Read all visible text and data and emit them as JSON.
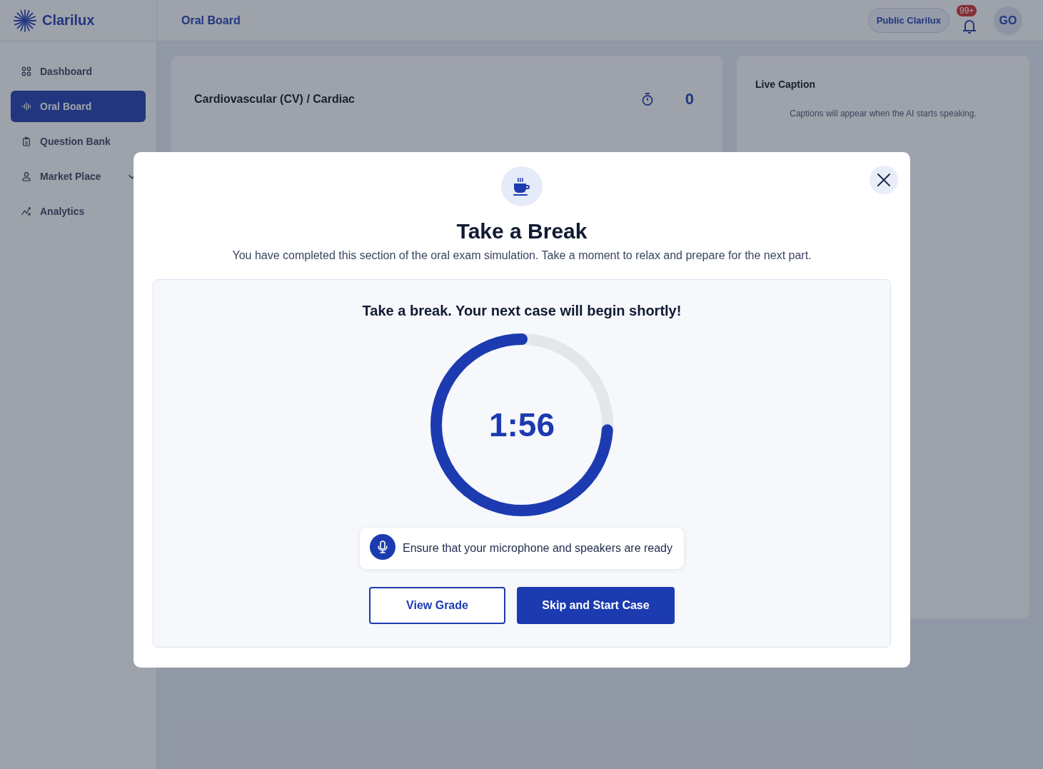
{
  "brand": {
    "name": "Clarilux"
  },
  "header": {
    "title": "Oral Board",
    "public_button": "Public Clarilux",
    "notification_badge": "99+",
    "avatar": "GO"
  },
  "sidebar": {
    "items": [
      {
        "label": "Dashboard",
        "selected": false,
        "kind": "link"
      },
      {
        "label": "Oral Board",
        "selected": true,
        "kind": "link"
      },
      {
        "label": "Question Bank",
        "selected": false,
        "kind": "link"
      },
      {
        "label": "Market Place",
        "selected": false,
        "kind": "group",
        "expanded": false
      },
      {
        "label": "Analytics",
        "selected": false,
        "kind": "link"
      }
    ]
  },
  "exam_card": {
    "title": "Cardiovascular (CV) / Cardiac",
    "score": "0"
  },
  "caption_card": {
    "title": "Live Caption",
    "message": "Captions will appear when the AI starts speaking."
  },
  "modal": {
    "title": "Take a Break",
    "description": "You have completed this section of the oral exam simulation. Take a moment to relax and prepare for the next part.",
    "panel": {
      "heading": "Take a break. Your next case will begin shortly!",
      "timer": {
        "time": "1:56",
        "level": 0.74
      },
      "notice": "Ensure that your microphone and speakers are ready"
    },
    "buttons": [
      {
        "label": "View Grade",
        "kind": "secondary"
      },
      {
        "label": "Skip and Start Case",
        "kind": "primary"
      }
    ]
  }
}
